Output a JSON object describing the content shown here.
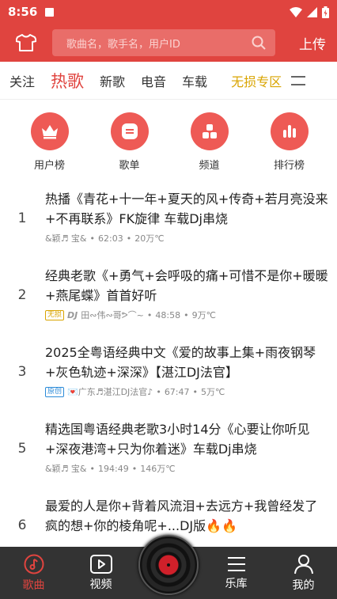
{
  "status_bar": {
    "time": "8:56"
  },
  "header": {
    "search_placeholder": "歌曲名，歌手名，用户ID",
    "upload_label": "上传"
  },
  "tabs": [
    {
      "label": "关注"
    },
    {
      "label": "热歌"
    },
    {
      "label": "新歌"
    },
    {
      "label": "电音"
    },
    {
      "label": "车载"
    },
    {
      "label": "无损专区"
    }
  ],
  "categories": [
    {
      "label": "用户榜",
      "icon": "crown-icon"
    },
    {
      "label": "歌单",
      "icon": "playlist-icon"
    },
    {
      "label": "频道",
      "icon": "channel-icon"
    },
    {
      "label": "排行榜",
      "icon": "chart-bars-icon"
    }
  ],
  "songs": [
    {
      "rank": "1",
      "title": "热播《青花+十一年+夏天的风+传奇+若月亮没来+不再联系》FK旋律 车载Dj串烧",
      "uploader": "&颖♬ 宝&",
      "duration": "62:03",
      "size": "20万℃"
    },
    {
      "rank": "2",
      "title": "经典老歌《+勇气+会呼吸的痛+可惜不是你+暖暖+燕尾蝶》首首好听",
      "badge": "无损",
      "dj": "DJ",
      "uploader": "田∾伟∾哥ᕗ⌒~",
      "duration": "48:58",
      "size": "9万℃"
    },
    {
      "rank": "3",
      "title": "2025全粤语经典中文《爱的故事上集+雨夜钢琴+灰色轨迹+深深》【湛江DJ法官】",
      "badge": "原创",
      "uploader": "💌广东♬湛江DJ法官♪",
      "duration": "67:47",
      "size": "5万℃"
    },
    {
      "rank": "5",
      "title": "精选国粤语经典老歌3小时14分《心要让你听见+深夜港湾+只为你着迷》车载Dj串烧",
      "uploader": "&颖♬ 宝&",
      "duration": "194:49",
      "size": "146万℃"
    },
    {
      "rank": "6",
      "title": "最爱的人是你+背着风流泪+去远方+我曾经发了疯的想+你的棱角呢+...DJ版🔥🔥",
      "uploader": "",
      "duration": "",
      "size": ""
    }
  ],
  "bottom_nav": [
    {
      "label": "歌曲"
    },
    {
      "label": "视频"
    },
    {
      "label": "乐库"
    },
    {
      "label": "我的"
    }
  ],
  "colors": {
    "brand": "#e0443f",
    "lossless": "#d9a400",
    "nav_bg": "#333333"
  }
}
